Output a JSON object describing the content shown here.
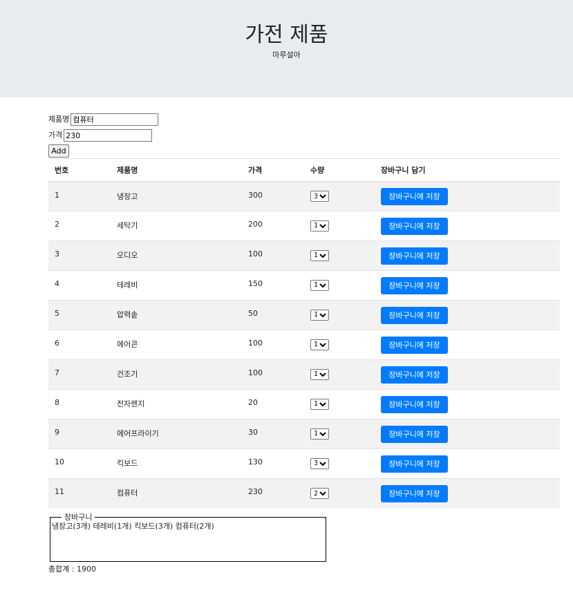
{
  "header": {
    "title": "가전 제품",
    "subtitle": "마루설아"
  },
  "form": {
    "name_label": "제품명",
    "name_value": "컴퓨터",
    "price_label": "가격",
    "price_value": "230",
    "add_label": "Add"
  },
  "table": {
    "headers": [
      "번호",
      "제품명",
      "가격",
      "수량",
      "장바구니 담기"
    ],
    "button_label": "장바구니에 저장",
    "rows": [
      {
        "no": "1",
        "name": "냉장고",
        "price": "300",
        "qty": "3"
      },
      {
        "no": "2",
        "name": "세탁기",
        "price": "200",
        "qty": "1"
      },
      {
        "no": "3",
        "name": "오디오",
        "price": "100",
        "qty": "1"
      },
      {
        "no": "4",
        "name": "테레비",
        "price": "150",
        "qty": "1"
      },
      {
        "no": "5",
        "name": "압력솥",
        "price": "50",
        "qty": "1"
      },
      {
        "no": "6",
        "name": "에어콘",
        "price": "100",
        "qty": "1"
      },
      {
        "no": "7",
        "name": "건조기",
        "price": "100",
        "qty": "1"
      },
      {
        "no": "8",
        "name": "전자렌지",
        "price": "20",
        "qty": "1"
      },
      {
        "no": "9",
        "name": "에어프라이기",
        "price": "30",
        "qty": "1"
      },
      {
        "no": "10",
        "name": "킥보드",
        "price": "130",
        "qty": "3"
      },
      {
        "no": "11",
        "name": "컴퓨터",
        "price": "230",
        "qty": "2"
      }
    ]
  },
  "cart": {
    "legend": "장바구니",
    "items": "냉장고(3개) 테레비(1개) 킥보드(3개) 컴퓨터(2개)"
  },
  "total": {
    "text": "총합계 : 1900"
  },
  "colors": {
    "header_bg": "#e9ecef",
    "button_primary": "#007bff",
    "stripe": "#f2f2f2"
  }
}
